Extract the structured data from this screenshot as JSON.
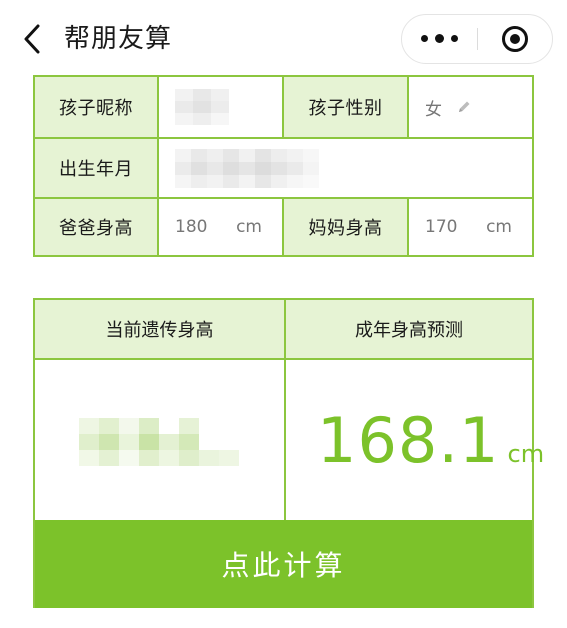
{
  "nav": {
    "back_icon": "chevron-left-icon",
    "title": "帮朋友算",
    "more_icon": "more-dots-icon",
    "close_icon": "target-circle-icon"
  },
  "form": {
    "nickname_label": "孩子昵称",
    "nickname_value": "",
    "gender_label": "孩子性别",
    "gender_value": "女",
    "gender_edit_icon": "pencil-icon",
    "birth_label": "出生年月",
    "birth_value": "",
    "father_label": "爸爸身高",
    "father_value": "180",
    "father_unit": "cm",
    "mother_label": "妈妈身高",
    "mother_value": "170",
    "mother_unit": "cm"
  },
  "result": {
    "current_label": "当前遗传身高",
    "current_value": "",
    "adult_label": "成年身高预测",
    "adult_value": "168.1",
    "adult_unit": "cm"
  },
  "calc_button": "点此计算",
  "colors": {
    "accent": "#7cc22a",
    "border": "#8cc63f",
    "label_bg": "#e6f3d4"
  }
}
